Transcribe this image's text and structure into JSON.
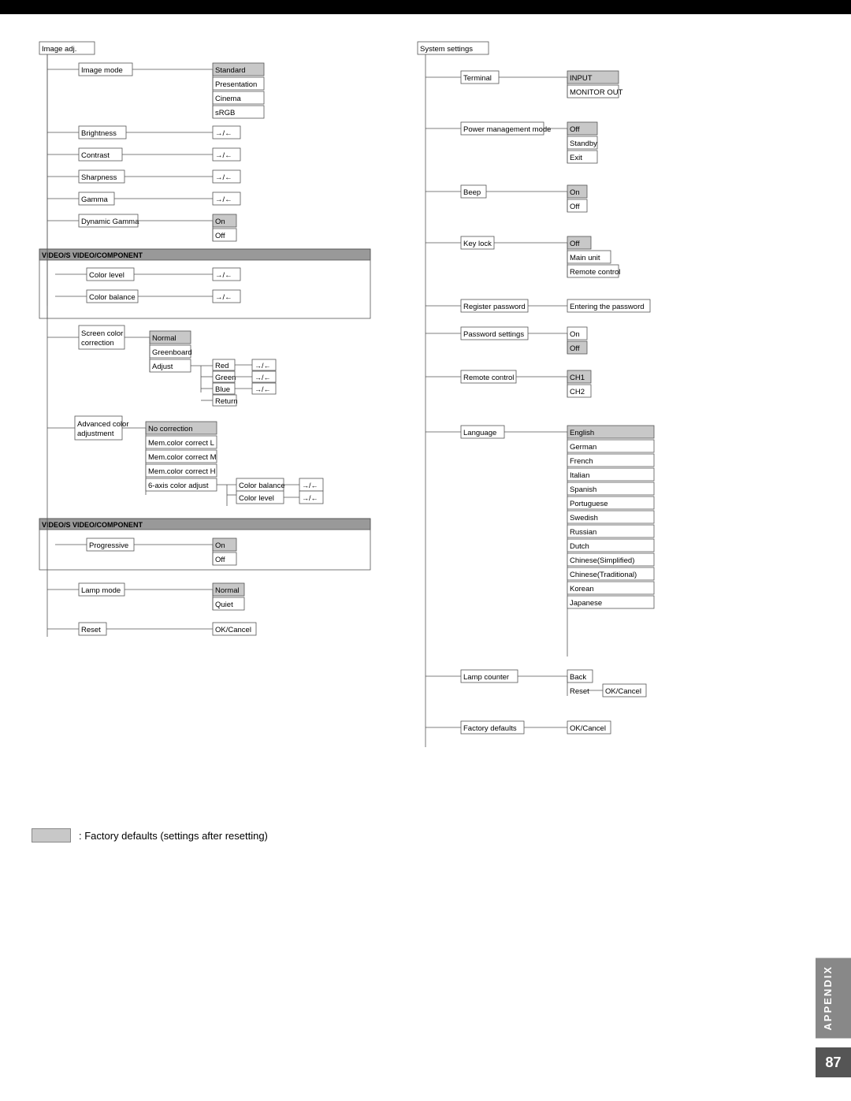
{
  "page": {
    "top_bar": "",
    "page_number": "87",
    "appendix_label": "APPENDIX"
  },
  "legend": {
    "label": ": Factory defaults (settings after resetting)"
  },
  "left_diagram": {
    "title": "Image adj.",
    "items": {
      "image_mode": {
        "label": "Image mode",
        "options": [
          "Standard",
          "Presentation",
          "Cinema",
          "sRGB"
        ],
        "shaded": [
          "Standard"
        ]
      },
      "brightness": {
        "label": "Brightness",
        "value": "→/←"
      },
      "contrast": {
        "label": "Contrast",
        "value": "→/←"
      },
      "sharpness": {
        "label": "Sharpness",
        "value": "→/←"
      },
      "gamma": {
        "label": "Gamma",
        "value": "→/←"
      },
      "dynamic_gamma": {
        "label": "Dynamic Gamma",
        "options": [
          "On",
          "Off"
        ],
        "shaded": [
          "On"
        ]
      }
    },
    "section_video": "VIDEO/S VIDEO/COMPONENT",
    "video_items": {
      "color_level": {
        "label": "Color level",
        "value": "→/←"
      },
      "color_balance": {
        "label": "Color balance",
        "value": "→/←"
      }
    },
    "screen_color": {
      "label": "Screen color correction",
      "options": [
        "Normal",
        "Greenboard",
        "Adjust"
      ],
      "shaded": [
        "Normal"
      ],
      "adjust_sub": {
        "items": [
          "Red",
          "Green",
          "Blue",
          "Return"
        ],
        "values": [
          "→/←",
          "→/←",
          "→/←"
        ]
      }
    },
    "advanced_color": {
      "label": "Advanced color adjustment",
      "options": [
        "No correction",
        "Mem.color correct L",
        "Mem.color correct M",
        "Mem.color correct H",
        "6-axis color adjust"
      ],
      "shaded": [
        "No correction"
      ],
      "six_axis": {
        "color_balance": "→/←",
        "color_level": "→/←"
      }
    },
    "section_video2": "VIDEO/S VIDEO/COMPONENT",
    "progressive": {
      "label": "Progressive",
      "options": [
        "On",
        "Off"
      ],
      "shaded": [
        "On"
      ]
    },
    "lamp_mode": {
      "label": "Lamp mode",
      "options": [
        "Normal",
        "Quiet"
      ],
      "shaded": [
        "Normal"
      ]
    },
    "reset": {
      "label": "Reset",
      "value": "OK/Cancel"
    }
  },
  "right_diagram": {
    "title": "System settings",
    "terminal": {
      "label": "Terminal",
      "options": [
        "INPUT",
        "MONITOR OUT"
      ],
      "shaded": [
        "INPUT"
      ]
    },
    "power_management": {
      "label": "Power management mode",
      "options": [
        "Off",
        "Standby",
        "Exit"
      ],
      "shaded": [
        "Off"
      ]
    },
    "beep": {
      "label": "Beep",
      "options": [
        "On",
        "Off"
      ],
      "shaded": [
        "On"
      ]
    },
    "key_lock": {
      "label": "Key lock",
      "options": [
        "Off",
        "Main unit",
        "Remote control"
      ],
      "shaded": [
        "Off"
      ]
    },
    "register_password": {
      "label": "Register password",
      "value": "Entering the password"
    },
    "password_settings": {
      "label": "Password settings",
      "options": [
        "On",
        "Off"
      ],
      "shaded": [
        "Off"
      ]
    },
    "remote_control": {
      "label": "Remote control",
      "options": [
        "CH1",
        "CH2"
      ],
      "shaded": [
        "CH1"
      ]
    },
    "language": {
      "label": "Language",
      "options": [
        "English",
        "German",
        "French",
        "Italian",
        "Spanish",
        "Portuguese",
        "Swedish",
        "Russian",
        "Dutch",
        "Chinese(Simplified)",
        "Chinese(Traditional)",
        "Korean",
        "Japanese"
      ],
      "shaded": [
        "English"
      ]
    },
    "lamp_counter": {
      "label": "Lamp counter",
      "sub": {
        "back": "Back",
        "reset": "Reset",
        "ok_cancel": "OK/Cancel"
      }
    },
    "factory_defaults": {
      "label": "Factory defaults",
      "value": "OK/Cancel"
    }
  }
}
